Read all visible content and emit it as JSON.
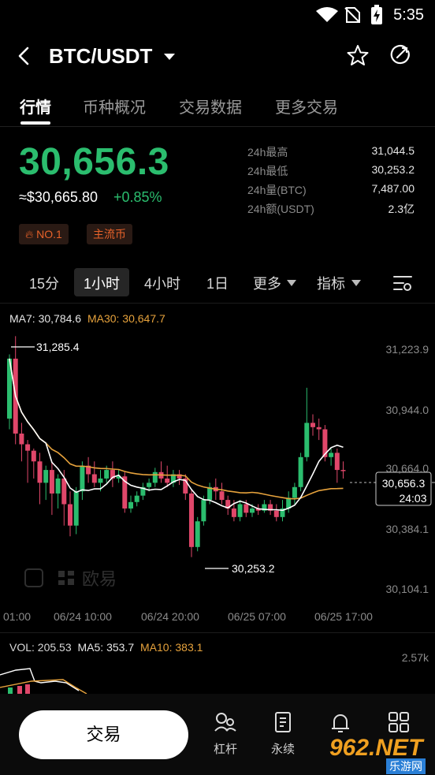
{
  "status_bar": {
    "time": "5:35"
  },
  "header": {
    "pair": "BTC/USDT"
  },
  "tabs": [
    {
      "label": "行情"
    },
    {
      "label": "币种概况"
    },
    {
      "label": "交易数据"
    },
    {
      "label": "更多交易"
    }
  ],
  "ticker": {
    "last_price": "30,656.3",
    "usd_price": "≈$30,665.80",
    "change": "+0.85%",
    "badges": [
      "NO.1",
      "主流币"
    ],
    "stats": [
      {
        "label": "24h最高",
        "value": "31,044.5"
      },
      {
        "label": "24h最低",
        "value": "30,253.2"
      },
      {
        "label": "24h量(BTC)",
        "value": "7,487.00"
      },
      {
        "label": "24h额(USDT)",
        "value": "2.3亿"
      }
    ]
  },
  "periods": [
    {
      "label": "15分"
    },
    {
      "label": "1小时"
    },
    {
      "label": "4小时"
    },
    {
      "label": "1日"
    },
    {
      "label": "更多"
    },
    {
      "label": "指标"
    }
  ],
  "chart": {
    "ma7": "MA7: 30,784.6",
    "ma30": "MA30: 30,647.7",
    "high_label": "31,285.4",
    "low_label": "30,253.2",
    "y_ticks": [
      "31,223.9",
      "30,944.0",
      "30,664.0",
      "30,384.1",
      "30,104.1"
    ],
    "x_ticks": [
      "01:00",
      "06/24 10:00",
      "06/24 20:00",
      "06/25 07:00",
      "06/25 17:00"
    ],
    "price_tag": "30,656.3",
    "countdown": "24:03",
    "watermark": "欧易",
    "colors": {
      "up": "#2bbd6e",
      "down": "#e0476a",
      "ma7": "#ffffff",
      "ma30": "#e6a23c"
    }
  },
  "volume": {
    "vol": "VOL: 205.53",
    "ma5": "MA5: 353.7",
    "ma10": "MA10: 383.1",
    "y_tick": "2.57k"
  },
  "bottom_nav": {
    "trade": "交易",
    "items": [
      {
        "label": "杠杆",
        "icon": "leverage-icon"
      },
      {
        "label": "永续",
        "icon": "perpetual-icon"
      },
      {
        "label": "",
        "icon": "bell-icon"
      },
      {
        "label": "",
        "icon": "grid-icon"
      }
    ]
  },
  "overlay_watermark": {
    "brand": "962.NET",
    "sub": "乐游网"
  }
}
